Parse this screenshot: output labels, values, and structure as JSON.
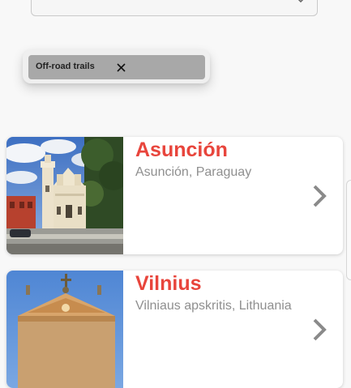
{
  "filter": {
    "chip_label": "Off-road trails"
  },
  "icons": {
    "search_dropdown": "chevron-down-icon",
    "chip_close": "close-icon",
    "card_open": "chevron-right-icon"
  },
  "places": [
    {
      "name": "Asunción",
      "region": "Asunción, Paraguay"
    },
    {
      "name": "Vilnius",
      "region": "Vilniaus apskritis, Lithuania"
    }
  ],
  "colors": {
    "accent": "#e8453c",
    "muted_text": "#8f8f8f",
    "chip_bg": "#a8a8a8"
  }
}
